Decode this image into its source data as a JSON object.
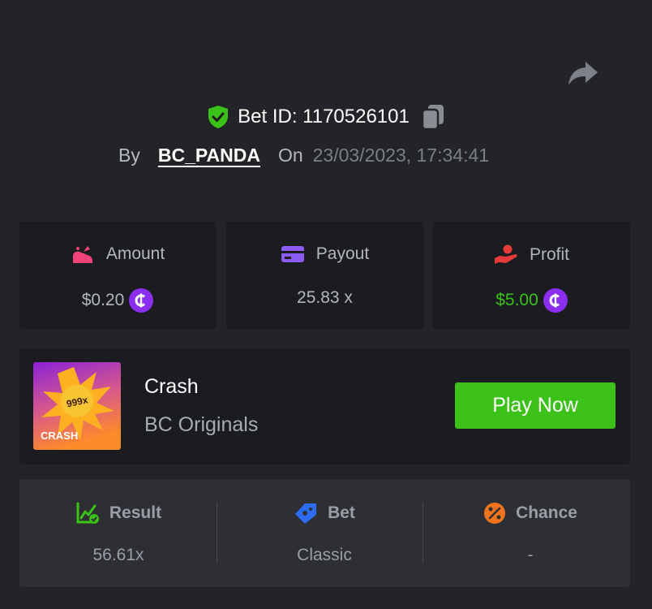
{
  "header": {
    "bet_id_label": "Bet ID: 1170526101",
    "by_label": "By",
    "username": "BC_PANDA",
    "on_label": "On",
    "datetime": "23/03/2023, 17:34:41"
  },
  "stats": [
    {
      "label": "Amount",
      "value": "$0.20",
      "icon": "money-bag-icon"
    },
    {
      "label": "Payout",
      "value": "25.83 x",
      "icon": "card-icon"
    },
    {
      "label": "Profit",
      "value": "$5.00",
      "icon": "hand-coin-icon"
    }
  ],
  "game": {
    "title": "Crash",
    "provider": "BC Originals",
    "button_label": "Play Now",
    "thumb_multiplier": "999x",
    "thumb_label": "CRASH"
  },
  "details": [
    {
      "label": "Result",
      "value": "56.61x",
      "icon": "chart-check-icon"
    },
    {
      "label": "Bet",
      "value": "Classic",
      "icon": "ticket-icon"
    },
    {
      "label": "Chance",
      "value": "-",
      "icon": "percent-icon"
    }
  ],
  "colors": {
    "background": "#232428",
    "card": "#1a1c20",
    "accent_green": "#3bc117",
    "coin_purple": "#8b2ef0",
    "result_card": "#2d2f34"
  }
}
